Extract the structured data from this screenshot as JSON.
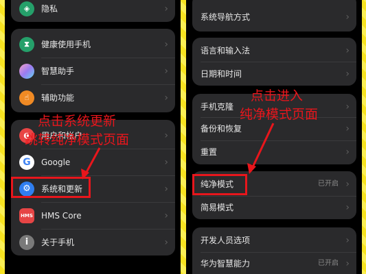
{
  "left": {
    "g1": [
      {
        "label": "隐私",
        "icon": "shield-icon",
        "color": "#25a06a",
        "glyph": "⬤"
      }
    ],
    "g2": [
      {
        "label": "健康使用手机",
        "icon": "hourglass-icon",
        "color": "#25a06a",
        "glyph": "⌛"
      },
      {
        "label": "智慧助手",
        "icon": "ai-assistant-icon",
        "color": "#c67be0",
        "glyph": ""
      },
      {
        "label": "辅助功能",
        "icon": "accessibility-icon",
        "color": "#f08a24",
        "glyph": "☝"
      }
    ],
    "g3": [
      {
        "label": "用户和帐户",
        "icon": "user-icon",
        "color": "#e84545",
        "glyph": "👤"
      },
      {
        "label": "Google",
        "icon": "google-icon",
        "color": "#ffffff",
        "glyph": "G"
      },
      {
        "label": "系统和更新",
        "icon": "gear-icon",
        "color": "#2f7ef0",
        "glyph": "⚙"
      },
      {
        "label": "HMS Core",
        "icon": "hms-icon",
        "color": "#e64545",
        "glyph": "HMS"
      },
      {
        "label": "关于手机",
        "icon": "info-icon",
        "color": "#8a8a8a",
        "glyph": "i"
      }
    ]
  },
  "right": {
    "g1": [
      {
        "label": "系统导航方式"
      }
    ],
    "g2": [
      {
        "label": "语言和输入法"
      },
      {
        "label": "日期和时间"
      }
    ],
    "g3": [
      {
        "label": "手机克隆"
      },
      {
        "label": "备份和恢复"
      },
      {
        "label": "重置"
      }
    ],
    "g4": [
      {
        "label": "纯净模式",
        "status": "已开启"
      },
      {
        "label": "简易模式"
      }
    ],
    "g5": [
      {
        "label": "开发人员选项"
      },
      {
        "label": "华为智慧能力",
        "status": "已开启"
      }
    ]
  },
  "annotations": {
    "left_line1": "点击系统更新",
    "left_line2": "跳转纯净模式页面",
    "right_line1": "点击进入",
    "right_line2": "纯净模式页面"
  },
  "chevron": "›"
}
